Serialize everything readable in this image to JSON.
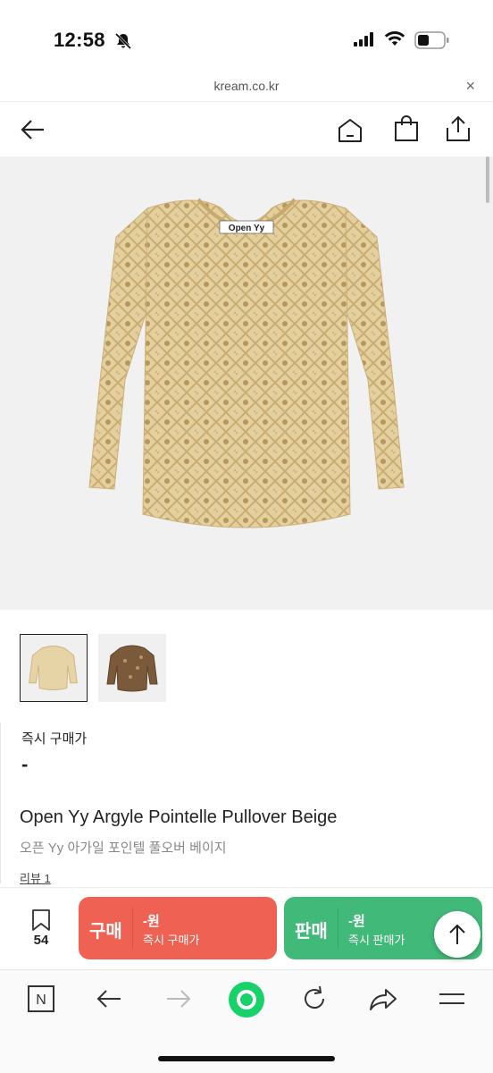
{
  "status": {
    "time": "12:58"
  },
  "browser": {
    "url": "kream.co.kr",
    "close_glyph": "×"
  },
  "header": {
    "back_icon": "arrow-left-icon",
    "home_icon": "home-icon",
    "bag_icon": "shopping-bag-icon",
    "share_icon": "share-icon"
  },
  "product": {
    "image_label": "Open Yy",
    "price_label": "즉시 구매가",
    "price_value": "-",
    "title": "Open Yy Argyle Pointelle Pullover Beige",
    "subtitle": "오픈 Yy 아가일 포인텔 풀오버 베이지",
    "review": "리뷰 1"
  },
  "bottom": {
    "bookmark_count": "54",
    "buy": {
      "label": "구매",
      "price": "-원",
      "sub": "즉시 구매가",
      "color": "#ef6253"
    },
    "sell": {
      "label": "판매",
      "price": "-원",
      "sub": "즉시 판매가",
      "color": "#41b979"
    }
  },
  "toolbar": {
    "naver_label": "N"
  }
}
